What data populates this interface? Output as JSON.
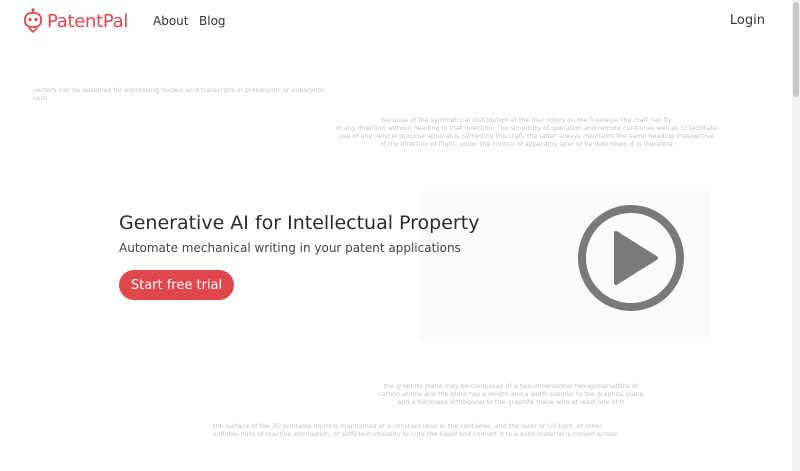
{
  "nav": {
    "brand": "PatentPal",
    "links": [
      "About",
      "Blog"
    ],
    "login": "Login"
  },
  "background_text": [
    "vectors can be designed for expressing nucleic acid transcripts in prokaryotic or eukaryotic\ncells",
    "because of the symmetrical distribution of the four rotors on the fuselage, the craft can fly\nin any direction without heading in that direction. The simplicity of operation and remote control as well as to facilitate\nuse of any vehicle purpose apparatus carried by the craft, the latter always maintains the same heading irrespective\nof the direction of flight, under the control of apparatus later to be described. It is therefore",
    "the graphite plane may be composed of a two-dimensional hexagonal lattice of\ncarbon atoms and the plate has a length and a width parallel to the graphite plane\nand a thickness orthogonal to the graphite plane with at least one of it",
    "the surface of the 3D printable liquid is maintained at a constant level in the container, and the laser or UV light, or other\nsuitable form of reactive stimulation, of sufficient intensity to cure the liquid and convert it to a solid material is moved across"
  ],
  "hero": {
    "title": "Generative AI for Intellectual Property",
    "subtitle": "Automate mechanical writing in your patent applications",
    "cta": "Start free trial"
  },
  "icons": {
    "logo": "robot-head-icon",
    "play": "play-icon"
  },
  "colors": {
    "brand": "#e0474c",
    "play_icon": "#7a7a7a"
  }
}
